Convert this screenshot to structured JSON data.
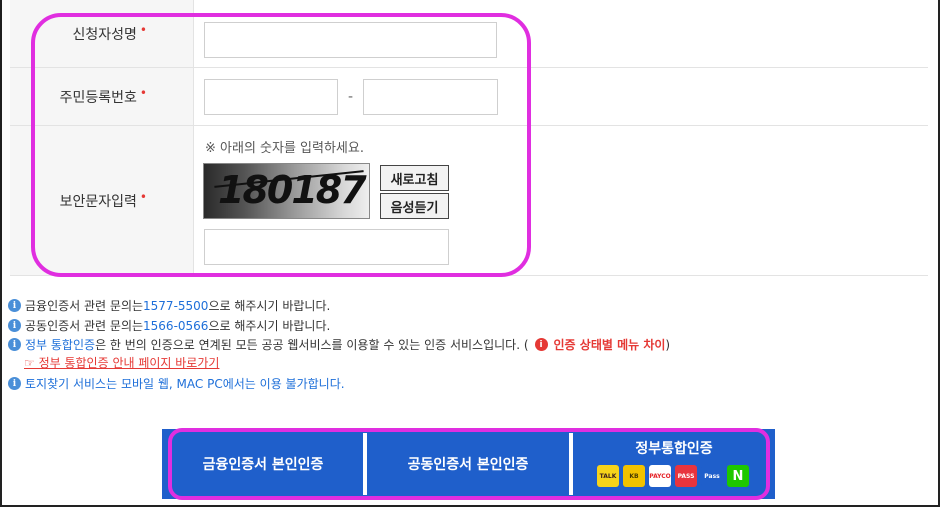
{
  "form": {
    "name_label": "신청자성명",
    "rrn_label": "주민등록번호",
    "rrn_separator": "-",
    "captcha_label": "보안문자입력",
    "required_mark": "•",
    "captcha_notice": "※ 아래의 숫자를 입력하세요.",
    "captcha_value": "180187",
    "refresh_button": "새로고침",
    "audio_button": "음성듣기",
    "name_value": "",
    "rrn_front_value": "",
    "rrn_back_value": "",
    "captcha_input_value": ""
  },
  "info": {
    "line1_prefix": "금융인증서 관련 문의는",
    "line1_phone": "1577-5500",
    "line1_suffix": " 으로 해주시기 바랍니다.",
    "line2_prefix": "공동인증서 관련 문의는",
    "line2_phone": "1566-0566",
    "line2_suffix": " 으로 해주시기 바랍니다.",
    "line3_blue": "정부 통합인증",
    "line3_text": "은 한 번의 인증으로 연계된 모든 공공 웹서비스를 이용할 수 있는 인증 서비스입니다.  (",
    "line3_red": "인증 상태별 메뉴 차이",
    "line3_close": " )",
    "link_text": "☞ 정부 통합인증 안내 페이지 바로가기",
    "line4": "토지찾기 서비스는 모바일 웹, MAC PC에서는 이용 불가합니다."
  },
  "buttons": {
    "financial_cert": "금융인증서 본인인증",
    "joint_cert": "공동인증서 본인인증",
    "gov_cert": "정부통합인증",
    "gov_icons": [
      {
        "label": "TALK",
        "icon": "kakao-icon",
        "bg": "#f7d31a",
        "fg": "#3a1d1d"
      },
      {
        "label": "KB",
        "icon": "kb-icon",
        "bg": "#f2c200",
        "fg": "#4a3b00"
      },
      {
        "label": "PAYCO",
        "icon": "payco-icon",
        "bg": "#ffffff",
        "fg": "#e52329"
      },
      {
        "label": "PASS",
        "icon": "pass-red-icon",
        "bg": "#e8343e",
        "fg": "#ffffff"
      },
      {
        "label": "Pass",
        "icon": "samsung-pass-icon",
        "bg": "#1f5fcb",
        "fg": "#ffffff"
      },
      {
        "label": "N",
        "icon": "naver-icon",
        "bg": "#1ec800",
        "fg": "#ffffff"
      }
    ]
  },
  "colors": {
    "highlight": "#e02ee0",
    "button_bg": "#1f5fcb",
    "link_blue": "#1e6fd9",
    "alert_red": "#e53935"
  }
}
